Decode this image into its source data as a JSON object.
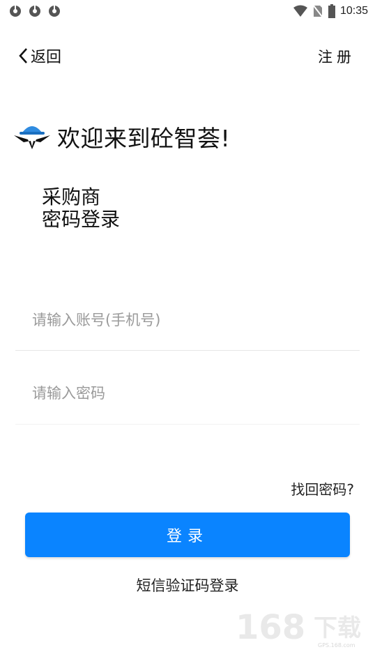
{
  "status_bar": {
    "time": "10:35",
    "icons_left": [
      "app-icon",
      "app-icon",
      "app-icon"
    ],
    "icons_right": [
      "wifi-icon",
      "sim-off-icon",
      "battery-icon"
    ]
  },
  "header": {
    "back_label": "返回",
    "register_label": "注册"
  },
  "welcome": {
    "title": "欢迎来到砼智荟!",
    "logo_icon": "helmet-eagle-logo"
  },
  "role": {
    "line1": "采购商",
    "line2": "密码登录"
  },
  "form": {
    "account_placeholder": "请输入账号(手机号)",
    "account_value": "",
    "password_placeholder": "请输入密码",
    "password_value": ""
  },
  "links": {
    "forgot_password": "找回密码?",
    "sms_login": "短信验证码登录"
  },
  "buttons": {
    "login_label": "登录"
  },
  "watermark": {
    "main_text": "168下载",
    "sub_text": "GPS.168.com"
  },
  "colors": {
    "primary": "#0a84ff",
    "text": "#111111",
    "placeholder": "#9a9a9a",
    "divider": "#e6e6e6"
  }
}
